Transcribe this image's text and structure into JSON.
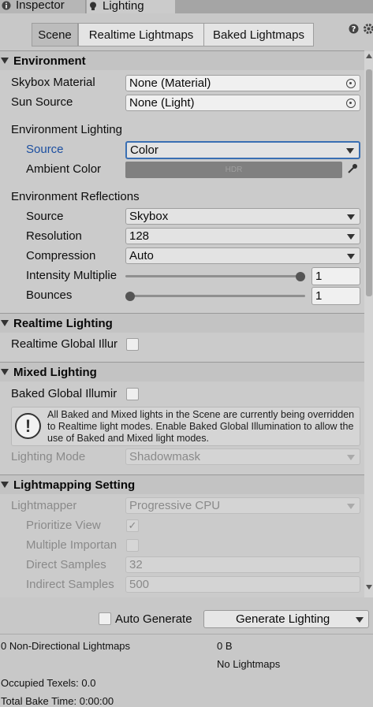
{
  "tabs": {
    "inspector": "Inspector",
    "lighting": "Lighting"
  },
  "toolbar": {
    "scene": "Scene",
    "realtime": "Realtime Lightmaps",
    "baked": "Baked Lightmaps",
    "help_icon": "question-circle",
    "settings_icon": "gear"
  },
  "environment": {
    "header": "Environment",
    "skybox_label": "Skybox Material",
    "skybox_value": "None (Material)",
    "sun_label": "Sun Source",
    "sun_value": "None (Light)",
    "lighting_header": "Environment Lighting",
    "source_label": "Source",
    "source_value": "Color",
    "ambient_label": "Ambient Color",
    "ambient_value": "HDR",
    "ambient_color": "#808080",
    "reflections_header": "Environment Reflections",
    "refl_source_label": "Source",
    "refl_source_value": "Skybox",
    "resolution_label": "Resolution",
    "resolution_value": "128",
    "compression_label": "Compression",
    "compression_value": "Auto",
    "intensity_label": "Intensity Multiplie",
    "intensity_value": "1",
    "intensity_fraction": 1,
    "bounces_label": "Bounces",
    "bounces_value": "1",
    "bounces_fraction": 0
  },
  "realtime": {
    "header": "Realtime Lighting",
    "gi_label": "Realtime Global Illur",
    "gi_checked": false
  },
  "mixed": {
    "header": "Mixed Lighting",
    "baked_gi_label": "Baked Global Illumir",
    "baked_gi_checked": false,
    "info_text": "All Baked and Mixed lights in the Scene are currently being overridden to Realtime light modes. Enable Baked Global Illumination to allow the use of Baked and Mixed light modes.",
    "mode_label": "Lighting Mode",
    "mode_value": "Shadowmask"
  },
  "lightmapping": {
    "header": "Lightmapping Setting",
    "lightmapper_label": "Lightmapper",
    "lightmapper_value": "Progressive CPU",
    "prioritize_label": "Prioritize View",
    "prioritize_check": "✓",
    "mis_label": "Multiple Importan",
    "direct_label": "Direct Samples",
    "direct_value": "32",
    "indirect_label": "Indirect Samples",
    "indirect_value": "500"
  },
  "footer": {
    "auto_label": "Auto Generate",
    "generate_label": "Generate Lighting",
    "stats_lightmaps": "0 Non-Directional Lightmaps",
    "stats_size": "0 B",
    "stats_none": "No Lightmaps",
    "occupied": "Occupied Texels: 0.0",
    "total_bake": "Total Bake Time: 0:00:00"
  },
  "colors": {
    "accent": "#3a6fb3",
    "label_blue": "#1c4fa0"
  }
}
